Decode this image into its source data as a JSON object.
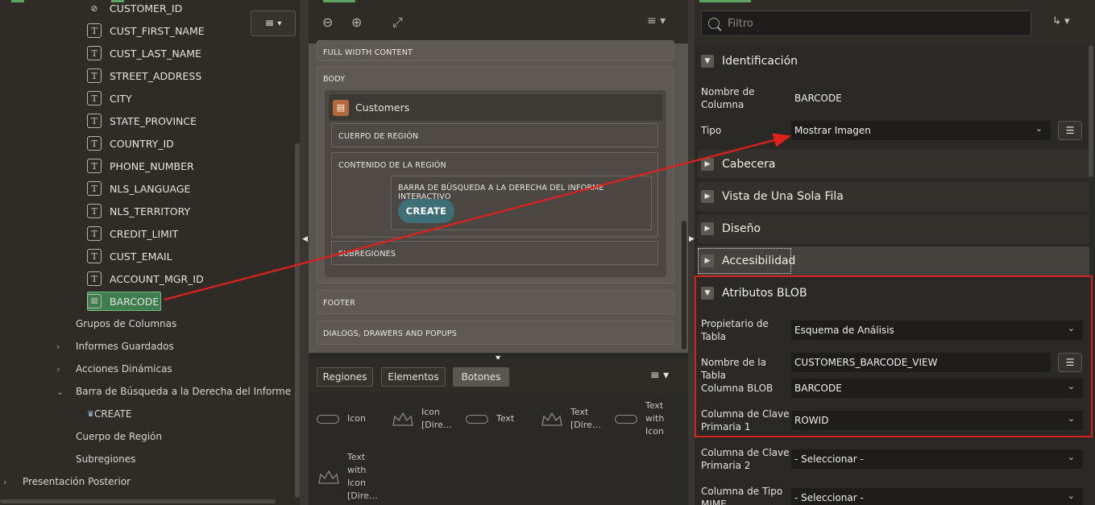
{
  "left_tree": {
    "columns": [
      "CUSTOMER_ID",
      "CUST_FIRST_NAME",
      "CUST_LAST_NAME",
      "STREET_ADDRESS",
      "CITY",
      "STATE_PROVINCE",
      "COUNTRY_ID",
      "PHONE_NUMBER",
      "NLS_LANGUAGE",
      "NLS_TERRITORY",
      "CREDIT_LIMIT",
      "CUST_EMAIL",
      "ACCOUNT_MGR_ID"
    ],
    "selected_column": "BARCODE",
    "groups": {
      "column_groups": "Grupos de Columnas",
      "saved_reports": "Informes Guardados",
      "dynamic_actions": "Acciones Dinámicas",
      "search_bar": "Barra de Búsqueda a la Derecha del Informe Interactivo",
      "create_button": "CREATE",
      "region_body": "Cuerpo de Región",
      "subregions": "Subregiones",
      "post_rendering": "Presentación Posterior"
    }
  },
  "layout": {
    "full_width": "FULL WIDTH CONTENT",
    "body": "BODY",
    "region_title": "Customers",
    "region_body": "CUERPO DE REGIÓN",
    "region_content": "CONTENIDO DE LA REGIÓN",
    "search_bar": "BARRA DE BÚSQUEDA A LA DERECHA DEL INFORME INTERACTIVO",
    "create": "CREATE",
    "subregions": "SUBREGIONES",
    "footer": "FOOTER",
    "dialogs": "DIALOGS, DRAWERS AND POPUPS"
  },
  "gallery": {
    "tabs": [
      "Regiones",
      "Elementos",
      "Botones"
    ],
    "active_tab": "Botones",
    "items": [
      [
        "Icon"
      ],
      [
        "Icon",
        "[Dire…"
      ],
      [
        "Text"
      ],
      [
        "Text",
        "[Dire…"
      ],
      [
        "Text",
        "with",
        "Icon"
      ],
      [
        "Text",
        "with",
        "Icon",
        "[Dire…"
      ]
    ]
  },
  "properties": {
    "filter_placeholder": "Filtro",
    "sections": {
      "identificacion": "Identificación",
      "cabecera": "Cabecera",
      "vista": "Vista de Una Sola Fila",
      "diseno": "Diseño",
      "accesibilidad": "Accesibilidad",
      "blob": "Atributos BLOB"
    },
    "column_name_label": "Nombre de Columna",
    "column_name_value": "BARCODE",
    "type_label": "Tipo",
    "type_value": "Mostrar Imagen",
    "table_owner_label": "Propietario de Tabla",
    "table_owner_value": "Esquema de Análisis",
    "table_name_label": "Nombre de la Tabla",
    "table_name_value": "CUSTOMERS_BARCODE_VIEW",
    "blob_column_label": "Columna BLOB",
    "blob_column_value": "BARCODE",
    "pk1_label": "Columna de Clave Primaria 1",
    "pk1_value": "ROWID",
    "pk2_label": "Columna de Clave Primaria 2",
    "pk2_value": "- Seleccionar -",
    "mime_label": "Columna de Tipo MIME",
    "mime_value": "- Seleccionar -"
  },
  "colors": {
    "selection": "#3e7d4f",
    "highlight_box": "#d8201c",
    "create_button": "#3e6f77"
  }
}
